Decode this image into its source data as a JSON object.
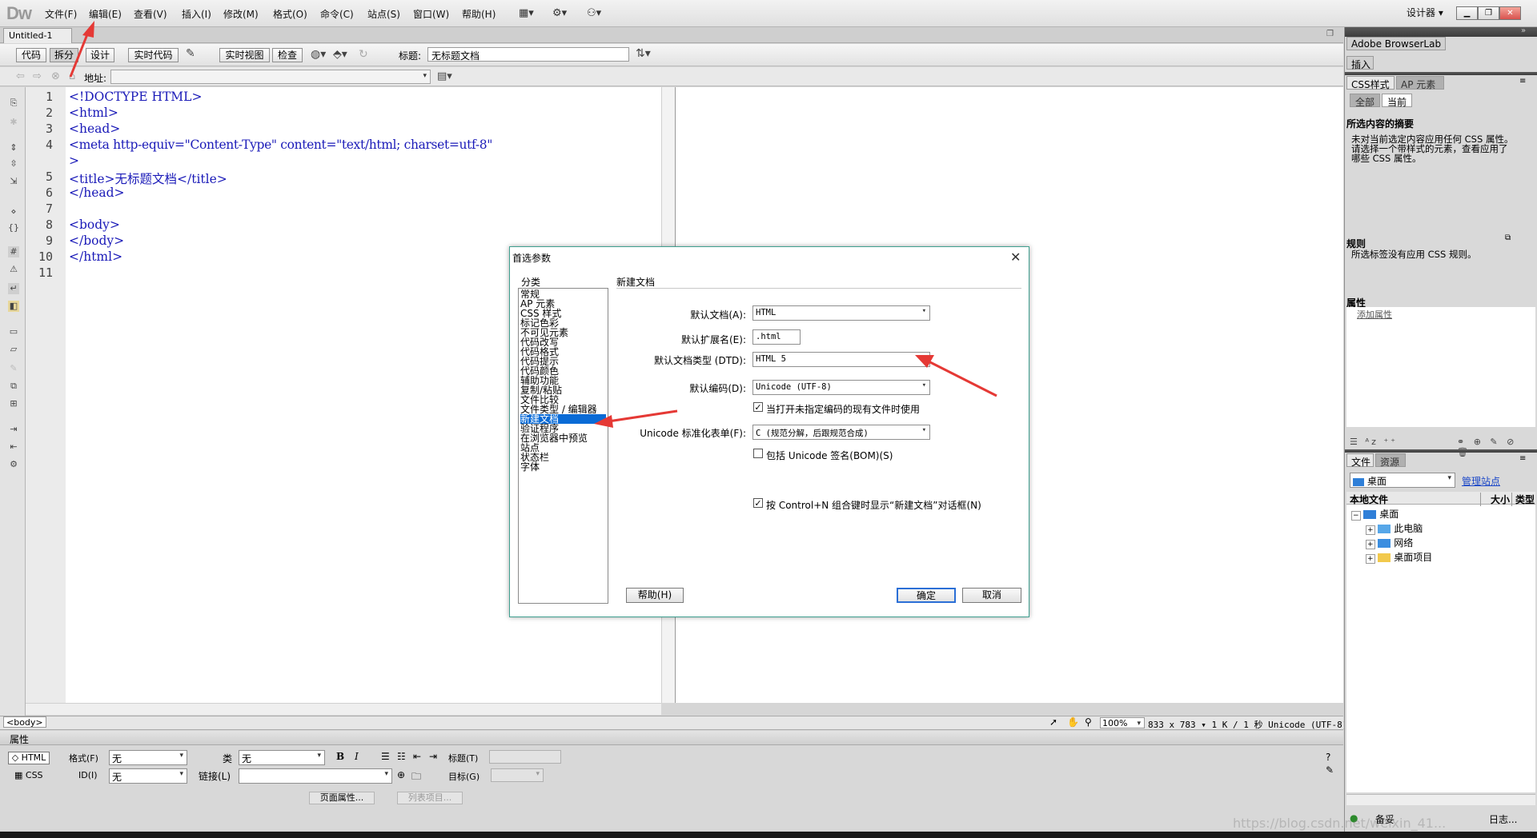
{
  "app": {
    "logo": "Dw",
    "menu": [
      "文件(F)",
      "编辑(E)",
      "查看(V)",
      "插入(I)",
      "修改(M)",
      "格式(O)",
      "命令(C)",
      "站点(S)",
      "窗口(W)",
      "帮助(H)"
    ],
    "workspace": "设计器 ▾"
  },
  "doc_tab": "Untitled-1",
  "doc_tab_close": "×",
  "view_buttons": [
    "代码",
    "拆分",
    "设计",
    "实时代码",
    "实时视图",
    "检查"
  ],
  "title_label": "标题:",
  "title_value": "无标题文档",
  "address_label": "地址:",
  "code": {
    "line_numbers": [
      "1",
      "2",
      "3",
      "4",
      "",
      "5",
      "6",
      "7",
      "8",
      "9",
      "10",
      "11"
    ],
    "lines": [
      "<!DOCTYPE HTML>",
      "<html>",
      "<head>",
      "<meta http-equiv=\"Content-Type\" content=\"text/html; charset=utf-8\"",
      ">",
      "<title>无标题文档</title>",
      "</head>",
      "",
      "<body>",
      "</body>",
      "</html>",
      ""
    ]
  },
  "status": {
    "tag": "<body>",
    "zoom": "100%",
    "info": "833 x 783 ▾ 1 K / 1 秒 Unicode (UTF-8)"
  },
  "properties": {
    "header": "属性",
    "html_btn": "HTML",
    "css_btn": "CSS",
    "format_label": "格式(F)",
    "format_value": "无",
    "class_label": "类",
    "class_value": "无",
    "id_label": "ID(I)",
    "id_value": "无",
    "link_label": "链接(L)",
    "title_label": "标题(T)",
    "target_label": "目标(G)",
    "page_props_btn": "页面属性...",
    "list_item_btn": "列表项目..."
  },
  "right_panel": {
    "browserlab": "Adobe BrowserLab",
    "insert": "插入",
    "css_tab": "CSS样式",
    "ap_tab": "AP 元素",
    "all_btn": "全部",
    "current_btn": "当前",
    "summary_title": "所选内容的摘要",
    "summary_text": "未对当前选定内容应用任何 CSS 属性。\n请选择一个带样式的元素，查看应用了\n哪些 CSS 属性。",
    "rules_title": "规则",
    "rules_text": "所选标签没有应用 CSS 规则。",
    "props_title": "属性",
    "add_prop": "添加属性",
    "files_tab": "文件",
    "assets_tab": "资源",
    "site_select": "桌面",
    "manage_sites": "管理站点",
    "local_files": "本地文件",
    "size_col": "大小",
    "type_col": "类型",
    "tree": [
      "桌面",
      "此电脑",
      "网络",
      "桌面项目"
    ],
    "ready": "备妥",
    "log": "日志..."
  },
  "dialog": {
    "title": "首选参数",
    "close": "✕",
    "category_label": "分类",
    "categories": [
      "常规",
      "AP 元素",
      "CSS 样式",
      "标记色彩",
      "不可见元素",
      "代码改写",
      "代码格式",
      "代码提示",
      "代码颜色",
      "辅助功能",
      "复制/粘贴",
      "文件比较",
      "文件类型 / 编辑器",
      "新建文档",
      "验证程序",
      "在浏览器中预览",
      "站点",
      "状态栏",
      "字体"
    ],
    "selected_category": 13,
    "section_title": "新建文档",
    "default_doc_label": "默认文档(A):",
    "default_doc_value": "HTML",
    "default_ext_label": "默认扩展名(E):",
    "default_ext_value": ".html",
    "default_dtd_label": "默认文档类型 (DTD):",
    "default_dtd_value": "HTML 5",
    "default_enc_label": "默认编码(D):",
    "default_enc_value": "Unicode (UTF-8)",
    "use_enc_label": "当打开未指定编码的现有文件时使用",
    "use_enc_checked": true,
    "unicode_norm_label": "Unicode 标准化表单(F):",
    "unicode_norm_value": "C (规范分解，后跟规范合成)",
    "bom_label": "包括 Unicode 签名(BOM)(S)",
    "bom_checked": false,
    "ctrl_n_label": "按 Control+N 组合键时显示“新建文档”对话框(N)",
    "ctrl_n_checked": true,
    "help_btn": "帮助(H)",
    "ok_btn": "确定",
    "cancel_btn": "取消"
  },
  "watermark": "https://blog.csdn.net/weixin_41...",
  "colors": {
    "annotation_arrow": "#e53935",
    "selection": "#0a6bd6",
    "dialog_border": "#3f9f8f"
  }
}
